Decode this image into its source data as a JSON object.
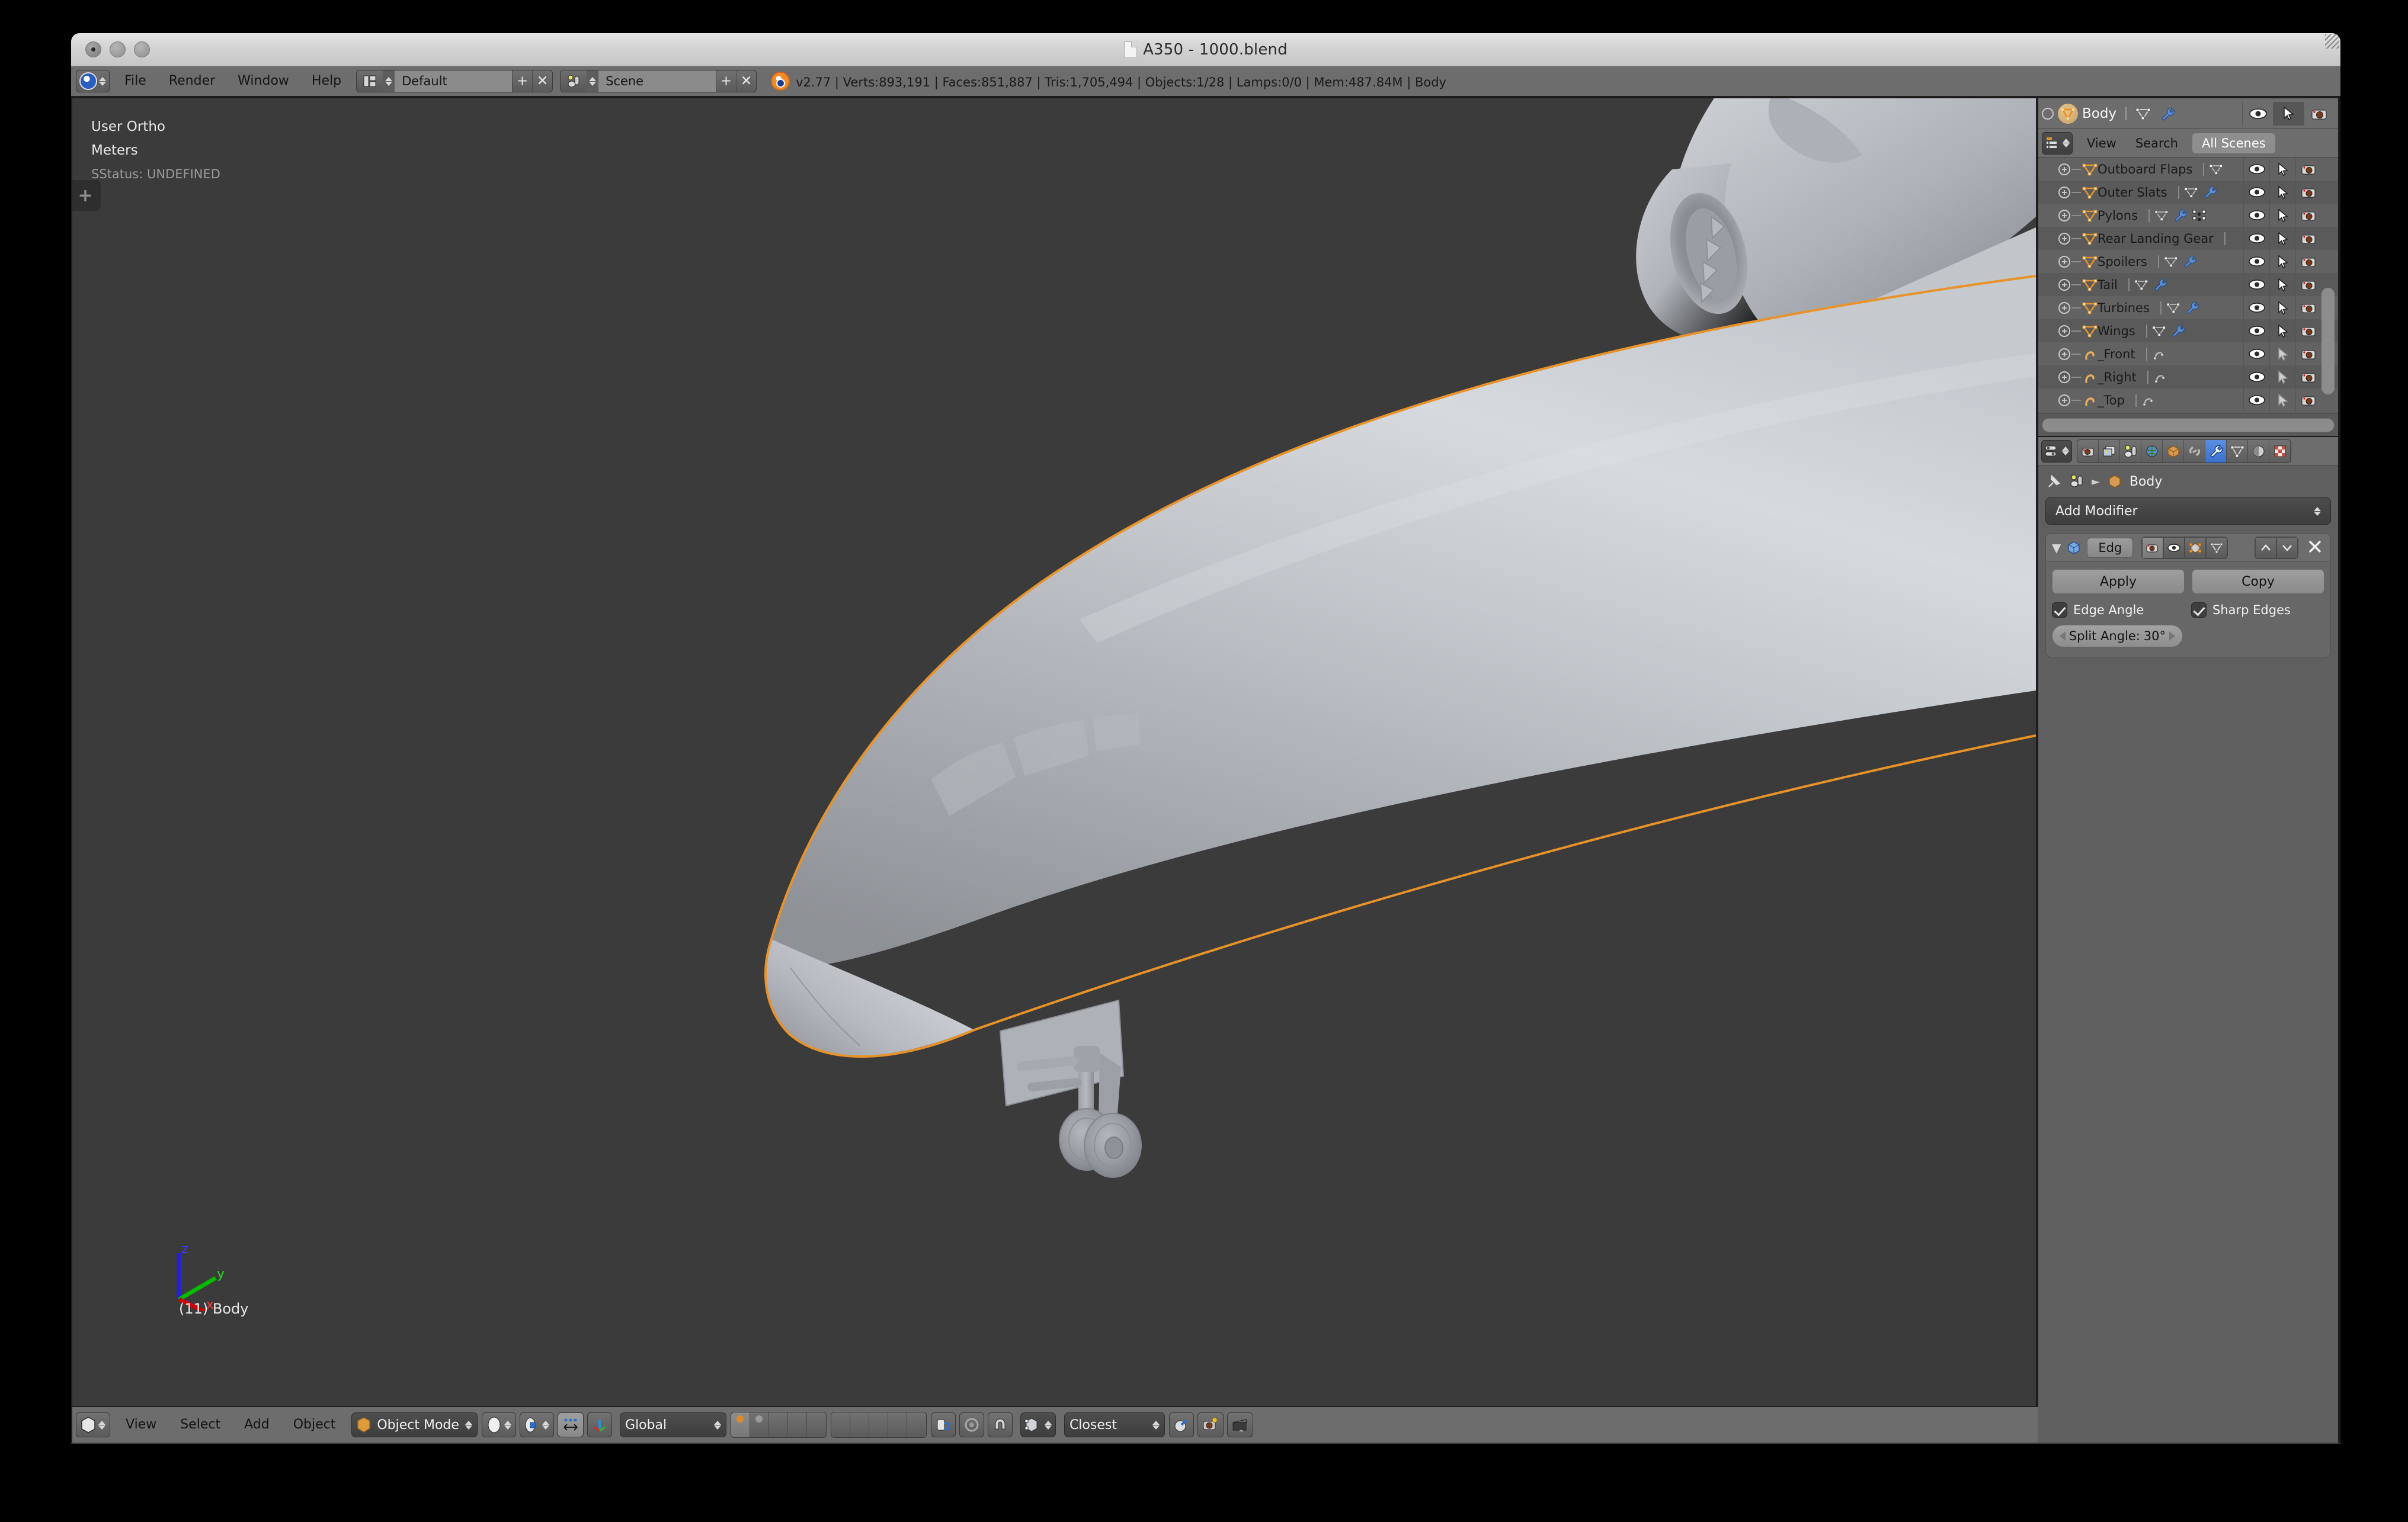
{
  "window": {
    "title": "A350 - 1000.blend",
    "traffic_lights": [
      "close",
      "minimize",
      "zoom"
    ]
  },
  "info_header": {
    "menus": [
      "File",
      "Render",
      "Window",
      "Help"
    ],
    "screen_layout": {
      "value": "Default",
      "add_label": "+",
      "remove_label": "✕"
    },
    "scene": {
      "value": "Scene",
      "add_label": "+",
      "remove_label": "✕"
    },
    "stats": "v2.77 | Verts:893,191 | Faces:851,887 | Tris:1,705,494 | Objects:1/28 | Lamps:0/0 | Mem:487.84M | Body",
    "version": "v2.77",
    "verts": "893,191",
    "faces": "851,887",
    "tris": "1,705,494",
    "objects": "1/28",
    "lamps": "0/0",
    "mem": "487.84M",
    "active_object": "Body"
  },
  "viewport": {
    "view_name": "User Ortho",
    "units": "Meters",
    "status_line": "SStatus: UNDEFINED",
    "object_label": "(11) Body",
    "toolbar_tab": "+",
    "axis": {
      "x": "x",
      "y": "y",
      "z": "z",
      "x_color": "#cc0000",
      "y_color": "#00bb00",
      "z_color": "#2222dd"
    },
    "background": "#3b3b3b",
    "selection_outline": "#e8932a"
  },
  "viewport_footer": {
    "menus": [
      "View",
      "Select",
      "Add",
      "Object"
    ],
    "mode": "Object Mode",
    "transform_orientation": "Global",
    "snap_target": "Closest"
  },
  "outliner": {
    "active_object": "Body",
    "menus": [
      "View",
      "Search"
    ],
    "display_mode": "All Scenes",
    "rows": [
      {
        "name": "Outboard Flaps",
        "type": "mesh",
        "has_mesh_icon": true,
        "has_modifier": false,
        "has_particles": false
      },
      {
        "name": "Outer Slats",
        "type": "mesh",
        "has_mesh_icon": true,
        "has_modifier": true,
        "has_particles": false
      },
      {
        "name": "Pylons",
        "type": "mesh",
        "has_mesh_icon": true,
        "has_modifier": true,
        "has_particles": true
      },
      {
        "name": "Rear Landing Gear",
        "type": "mesh",
        "has_mesh_icon": false,
        "has_modifier": false,
        "has_particles": false
      },
      {
        "name": "Spoilers",
        "type": "mesh",
        "has_mesh_icon": true,
        "has_modifier": true,
        "has_particles": false
      },
      {
        "name": "Tail",
        "type": "mesh",
        "has_mesh_icon": true,
        "has_modifier": true,
        "has_particles": false
      },
      {
        "name": "Turbines",
        "type": "mesh",
        "has_mesh_icon": true,
        "has_modifier": true,
        "has_particles": false
      },
      {
        "name": "Wings",
        "type": "mesh",
        "has_mesh_icon": true,
        "has_modifier": true,
        "has_particles": false
      },
      {
        "name": "_Front",
        "type": "curve",
        "has_mesh_icon": true,
        "has_modifier": false,
        "has_particles": false
      },
      {
        "name": "_Right",
        "type": "curve",
        "has_mesh_icon": true,
        "has_modifier": false,
        "has_particles": false
      },
      {
        "name": "_Top",
        "type": "curve",
        "has_mesh_icon": true,
        "has_modifier": false,
        "has_particles": false
      }
    ],
    "row_icons": [
      "eye-icon",
      "cursor-icon",
      "camera-icon"
    ]
  },
  "properties": {
    "tabs": [
      "render-icon",
      "render-layers-icon",
      "scene-icon",
      "world-icon",
      "object-icon",
      "constraints-icon",
      "modifier-icon",
      "data-icon",
      "material-icon",
      "texture-icon"
    ],
    "active_tab": "modifier-icon",
    "breadcrumb_scene": "scene-icon",
    "breadcrumb_object": "Body",
    "add_modifier_label": "Add Modifier",
    "modifier": {
      "name": "Edg",
      "apply_label": "Apply",
      "copy_label": "Copy",
      "edge_angle_label": "Edge Angle",
      "edge_angle_checked": true,
      "sharp_edges_label": "Sharp Edges",
      "sharp_edges_checked": true,
      "split_angle_label": "Split Angle:",
      "split_angle_value": "30°"
    }
  }
}
